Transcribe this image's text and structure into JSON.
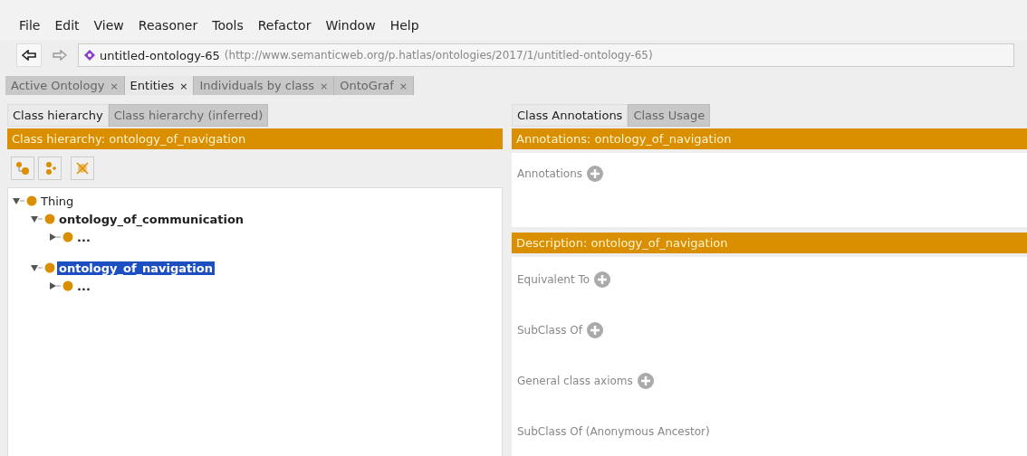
{
  "menu": [
    "File",
    "Edit",
    "View",
    "Reasoner",
    "Tools",
    "Refactor",
    "Window",
    "Help"
  ],
  "address": {
    "name": "untitled-ontology-65",
    "iri": "(http://www.semanticweb.org/p.hatlas/ontologies/2017/1/untitled-ontology-65)"
  },
  "tabs": [
    {
      "label": "Active Ontology",
      "close": "×",
      "selected": false
    },
    {
      "label": "Entities",
      "close": "×",
      "selected": true
    },
    {
      "label": "Individuals by class",
      "close": "×",
      "selected": false
    },
    {
      "label": "OntoGraf",
      "close": "×",
      "selected": false
    }
  ],
  "left": {
    "tabs": [
      {
        "label": "Class hierarchy",
        "selected": true
      },
      {
        "label": "Class hierarchy (inferred)",
        "selected": false
      }
    ],
    "header": "Class hierarchy: ontology_of_navigation",
    "tree": [
      {
        "label": "Thing",
        "expanded": true,
        "bold": false,
        "selected": false,
        "children": [
          {
            "label": "ontology_of_communication",
            "expanded": true,
            "bold": true,
            "selected": false,
            "children": [
              {
                "label": "...",
                "expanded": false,
                "bold": true,
                "selected": false
              }
            ]
          },
          {
            "label": "ontology_of_navigation",
            "expanded": true,
            "bold": true,
            "selected": true,
            "children": [
              {
                "label": "...",
                "expanded": false,
                "bold": true,
                "selected": false
              }
            ]
          }
        ]
      }
    ]
  },
  "right": {
    "tabs": [
      {
        "label": "Class Annotations",
        "selected": true
      },
      {
        "label": "Class Usage",
        "selected": false
      }
    ],
    "annotations_header": "Annotations: ontology_of_navigation",
    "annotations": [
      {
        "label": "Annotations",
        "add": true
      }
    ],
    "description_header": "Description: ontology_of_navigation",
    "description": [
      {
        "label": "Equivalent To",
        "add": true
      },
      {
        "label": "SubClass Of",
        "add": true
      },
      {
        "label": "General class axioms",
        "add": true
      },
      {
        "label": "SubClass Of (Anonymous Ancestor)",
        "add": false
      }
    ]
  }
}
